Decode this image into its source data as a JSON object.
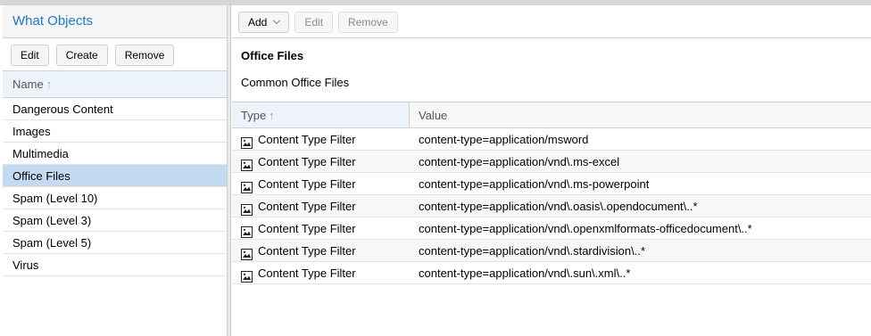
{
  "left_panel": {
    "title": "What Objects",
    "buttons": {
      "edit": "Edit",
      "create": "Create",
      "remove": "Remove"
    },
    "column": {
      "name": "Name",
      "sort_icon": "arrow-up-icon"
    },
    "items": [
      {
        "label": "Dangerous Content",
        "selected": false
      },
      {
        "label": "Images",
        "selected": false
      },
      {
        "label": "Multimedia",
        "selected": false
      },
      {
        "label": "Office Files",
        "selected": true
      },
      {
        "label": "Spam (Level 10)",
        "selected": false
      },
      {
        "label": "Spam (Level 3)",
        "selected": false
      },
      {
        "label": "Spam (Level 5)",
        "selected": false
      },
      {
        "label": "Virus",
        "selected": false
      }
    ]
  },
  "right_panel": {
    "buttons": {
      "add": "Add",
      "edit": "Edit",
      "remove": "Remove"
    },
    "group": {
      "name": "Office Files",
      "description": "Common Office Files"
    },
    "columns": {
      "type": "Type",
      "value": "Value",
      "sort_icon": "arrow-up-icon"
    },
    "rows": [
      {
        "type": "Content Type Filter",
        "value": "content-type=application/msword",
        "icon": "image-file-icon"
      },
      {
        "type": "Content Type Filter",
        "value": "content-type=application/vnd\\.ms-excel",
        "icon": "image-file-icon"
      },
      {
        "type": "Content Type Filter",
        "value": "content-type=application/vnd\\.ms-powerpoint",
        "icon": "image-file-icon"
      },
      {
        "type": "Content Type Filter",
        "value": "content-type=application/vnd\\.oasis\\.opendocument\\..*",
        "icon": "image-file-icon"
      },
      {
        "type": "Content Type Filter",
        "value": "content-type=application/vnd\\.openxmlformats-officedocument\\..*",
        "icon": "image-file-icon"
      },
      {
        "type": "Content Type Filter",
        "value": "content-type=application/vnd\\.stardivision\\..*",
        "icon": "image-file-icon"
      },
      {
        "type": "Content Type Filter",
        "value": "content-type=application/vnd\\.sun\\.xml\\..*",
        "icon": "image-file-icon"
      }
    ]
  },
  "colors": {
    "title_blue": "#1e78c8",
    "selected_row": "#c2dbf2",
    "header_bg": "#ecf3fb"
  }
}
